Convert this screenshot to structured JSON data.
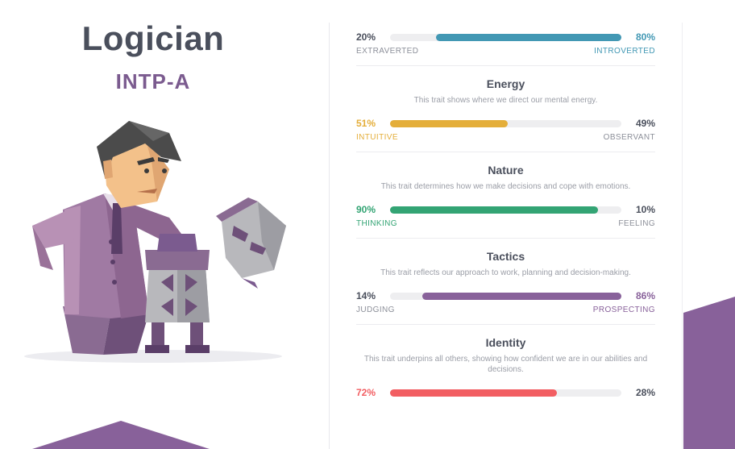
{
  "personality": {
    "name": "Logician",
    "code": "INTP-A"
  },
  "traits": [
    {
      "id": "mind",
      "title": "",
      "description": "",
      "left_percent": "20%",
      "right_percent": "80%",
      "left_label": "EXTRAVERTED",
      "right_label": "INTROVERTED",
      "dominant": "right",
      "value": 80,
      "color": "#4298b4"
    },
    {
      "id": "energy",
      "title": "Energy",
      "description": "This trait shows where we direct our mental energy.",
      "left_percent": "51%",
      "right_percent": "49%",
      "left_label": "INTUITIVE",
      "right_label": "OBSERVANT",
      "dominant": "left",
      "value": 51,
      "color": "#e4ae3a"
    },
    {
      "id": "nature",
      "title": "Nature",
      "description": "This trait determines how we make decisions and cope with emotions.",
      "left_percent": "90%",
      "right_percent": "10%",
      "left_label": "THINKING",
      "right_label": "FEELING",
      "dominant": "left",
      "value": 90,
      "color": "#33a474"
    },
    {
      "id": "tactics",
      "title": "Tactics",
      "description": "This trait reflects our approach to work, planning and decision-making.",
      "left_percent": "14%",
      "right_percent": "86%",
      "left_label": "JUDGING",
      "right_label": "PROSPECTING",
      "dominant": "right",
      "value": 86,
      "color": "#88619a"
    },
    {
      "id": "identity",
      "title": "Identity",
      "description": "This trait underpins all others, showing how confident we are in our abilities and decisions.",
      "left_percent": "72%",
      "right_percent": "28%",
      "left_label": "",
      "right_label": "",
      "dominant": "left",
      "value": 72,
      "color": "#f25e62"
    }
  ],
  "colors": {
    "text_dark": "#4a4f5c",
    "accent_purple": "#7b5b8f",
    "track": "#eeeef0",
    "muted": "#8c8f99"
  },
  "icons": {
    "character": "logician-illustration",
    "decoration": "purple-triangle-decoration"
  }
}
